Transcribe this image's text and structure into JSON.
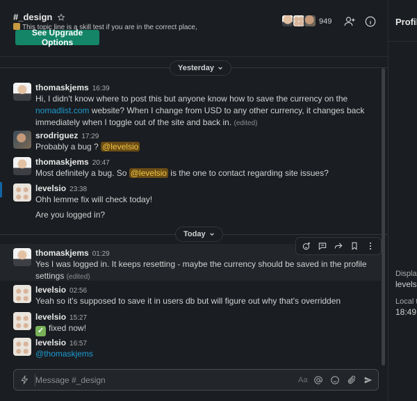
{
  "channel": {
    "name": "#_design",
    "topic": "This topic   line is a skill test if you are    in    the correct place,",
    "upgrade_label": "See Upgrade Options",
    "member_count": "949"
  },
  "right_panel": {
    "title": "Profile",
    "display_label": "Display",
    "display_value": "levelsio",
    "local_time_label": "Local ti",
    "local_time_value": "18:49"
  },
  "days": {
    "yesterday": "Yesterday",
    "today": "Today"
  },
  "messages": [
    {
      "author": "thomaskjems",
      "time": "16:39",
      "text_before": "Hi, I didn't know where to post this but anyone know how to save the currency on the ",
      "link": "nomadlist.com",
      "text_after": " website? When I change from USD to any other currency, it changes back immediately when I toggle out of the site and back in.",
      "edited": "(edited)"
    },
    {
      "author": "srodriguez",
      "time": "17:29",
      "text_before": "Probably a bug ? ",
      "mention": "@levelsio"
    },
    {
      "author": "thomaskjems",
      "time": "20:47",
      "text_before": "Most definitely a bug. So ",
      "mention": "@levelsio",
      "text_after": " is the one to contact regarding site issues?"
    },
    {
      "author": "levelsio",
      "time": "23:38",
      "text": "Ohh lemme fix will check today!",
      "text2": "Are you logged in?"
    },
    {
      "author": "thomaskjems",
      "time": "01:29",
      "text": "Yes I was logged in. It keeps resetting - maybe the currency should be saved in the profile settings",
      "edited": "(edited)"
    },
    {
      "author": "levelsio",
      "time": "02:56",
      "text": "Yeah so it's supposed to save it in users db but will figure out why that's overridden"
    },
    {
      "author": "levelsio",
      "time": "15:27",
      "checkmark": "✓",
      "text": "fixed now!"
    },
    {
      "author": "levelsio",
      "time": "16:57",
      "mention": "@thomaskjems"
    }
  ],
  "composer": {
    "placeholder": "Message #_design",
    "format_label": "Aa"
  }
}
